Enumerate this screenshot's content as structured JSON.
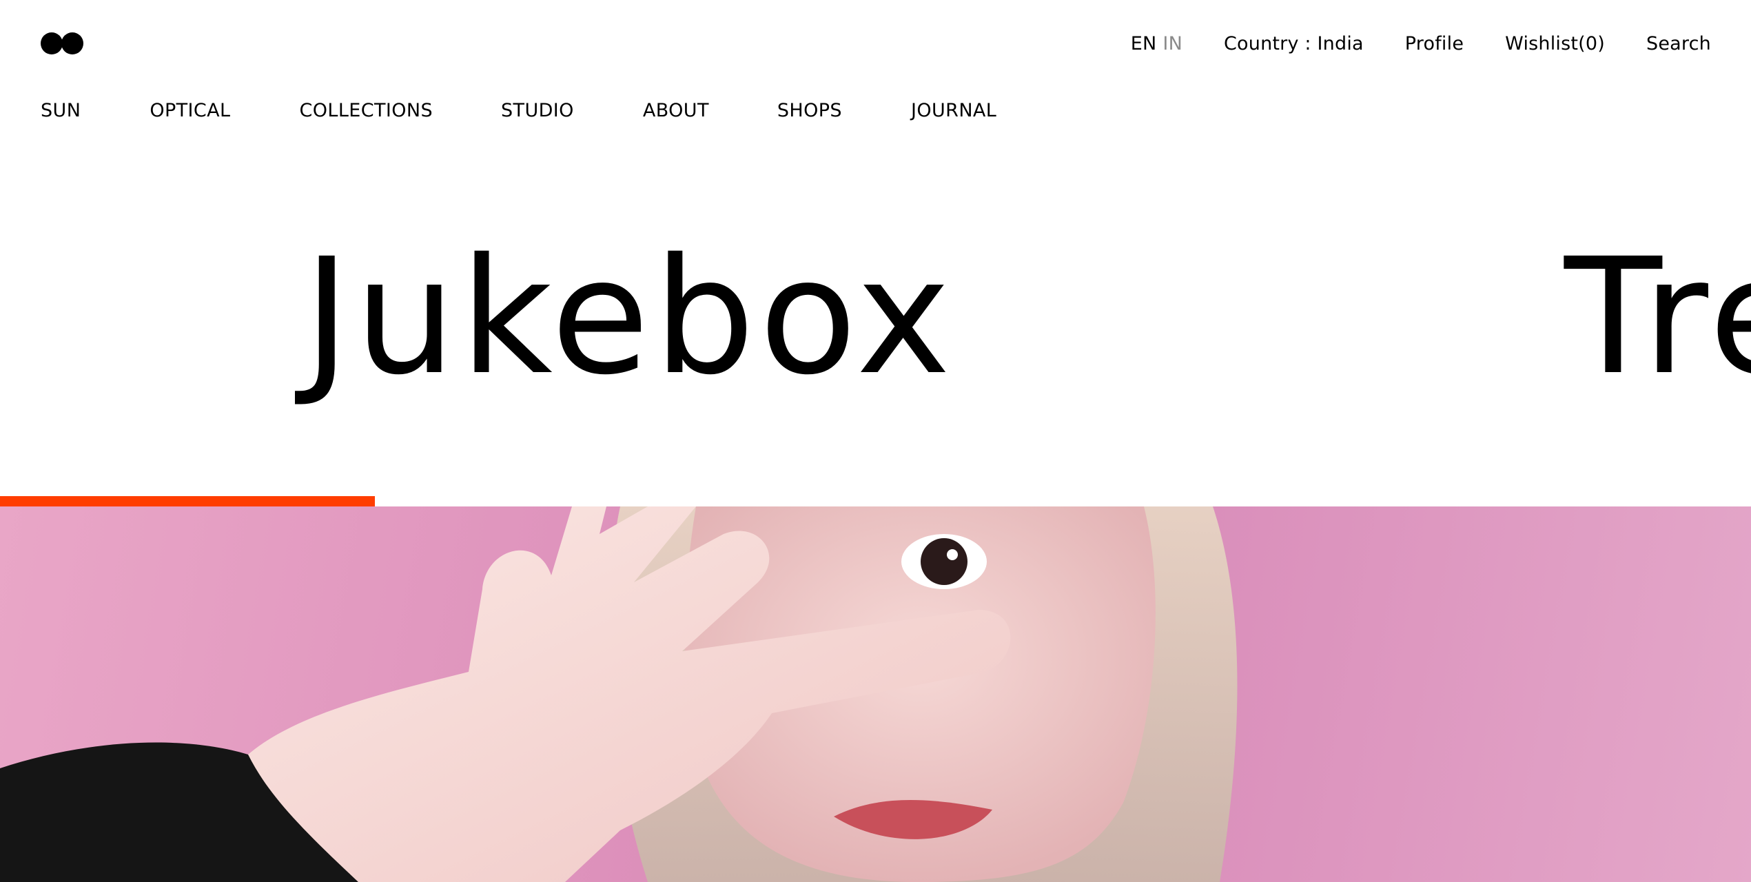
{
  "header": {
    "logo_label": "brand-logo",
    "lang": {
      "active": "EN",
      "inactive": "IN"
    },
    "country": "Country : India",
    "profile": "Profile",
    "wishlist": "Wishlist(0)",
    "search": "Search"
  },
  "nav": {
    "items": [
      {
        "label": "SUN"
      },
      {
        "label": "OPTICAL"
      },
      {
        "label": "COLLECTIONS"
      },
      {
        "label": "STUDIO"
      },
      {
        "label": "ABOUT"
      },
      {
        "label": "SHOPS"
      },
      {
        "label": "JOURNAL"
      }
    ]
  },
  "slider": {
    "current_title": "Jukebox",
    "next_title": "Tre",
    "progress_percent": 21.4,
    "accent_color": "#ff3d00"
  },
  "hero": {
    "background_color": "#dc8fba"
  }
}
